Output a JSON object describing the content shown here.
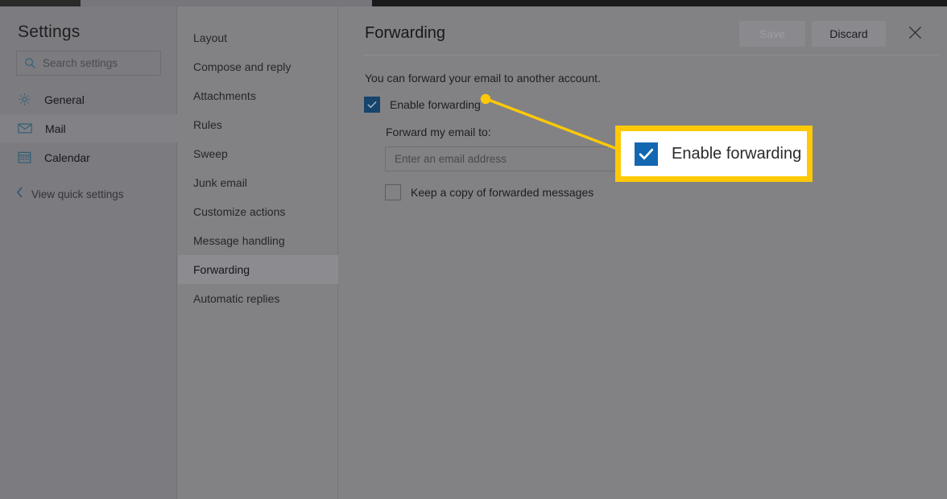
{
  "sidebar": {
    "title": "Settings",
    "search": {
      "placeholder": "Search settings",
      "icon": "search-icon"
    },
    "items": [
      {
        "label": "General",
        "icon": "gear-icon",
        "selected": false
      },
      {
        "label": "Mail",
        "icon": "envelope-icon",
        "selected": true
      },
      {
        "label": "Calendar",
        "icon": "calendar-icon",
        "selected": false
      }
    ],
    "quick_settings": {
      "label": "View quick settings",
      "icon": "chevron-left-icon"
    }
  },
  "nav": {
    "items": [
      {
        "label": "Layout",
        "selected": false
      },
      {
        "label": "Compose and reply",
        "selected": false
      },
      {
        "label": "Attachments",
        "selected": false
      },
      {
        "label": "Rules",
        "selected": false
      },
      {
        "label": "Sweep",
        "selected": false
      },
      {
        "label": "Junk email",
        "selected": false
      },
      {
        "label": "Customize actions",
        "selected": false
      },
      {
        "label": "Message handling",
        "selected": false
      },
      {
        "label": "Forwarding",
        "selected": true
      },
      {
        "label": "Automatic replies",
        "selected": false
      }
    ]
  },
  "main": {
    "title": "Forwarding",
    "save_label": "Save",
    "discard_label": "Discard",
    "close_icon": "close-icon",
    "intro": "You can forward your email to another account.",
    "enable_forwarding": {
      "label": "Enable forwarding",
      "checked": true
    },
    "forward_to_label": "Forward my email to:",
    "email_input": {
      "placeholder": "Enter an email address",
      "value": ""
    },
    "keep_copy": {
      "label": "Keep a copy of forwarded messages",
      "checked": false
    }
  },
  "annotation": {
    "callout_label": "Enable forwarding",
    "callout_checked": true,
    "highlight_color": "#FFC907",
    "checkbox_accent": "#1367b0"
  }
}
